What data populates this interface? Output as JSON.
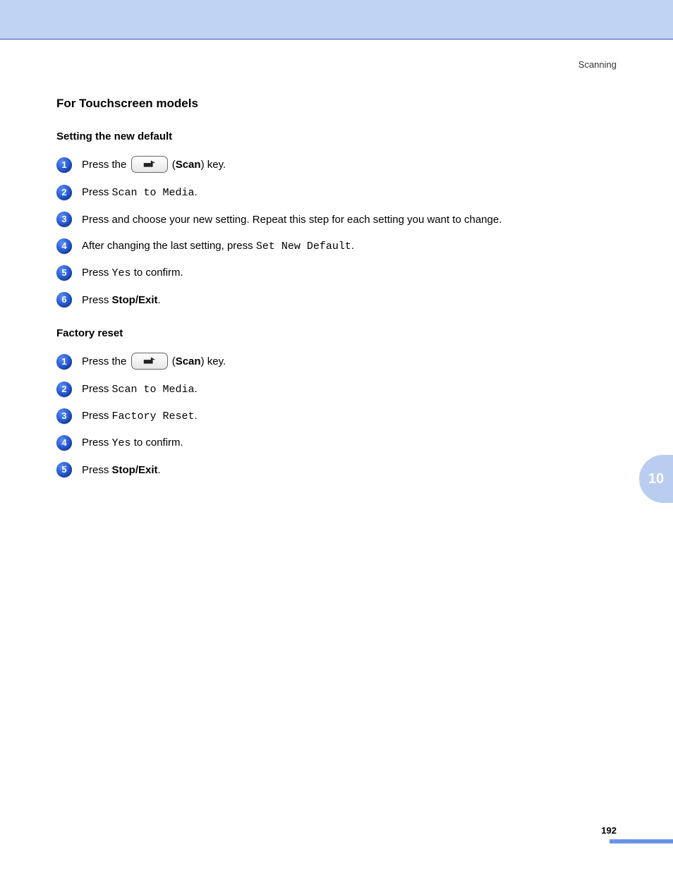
{
  "header": {
    "section": "Scanning"
  },
  "main_heading": "For Touchscreen models",
  "section_a": {
    "heading": "Setting the new default",
    "steps": [
      {
        "num": "1",
        "pre": "Press the ",
        "has_key": true,
        "post_open": " (",
        "bold": "Scan",
        "post_close": ") key."
      },
      {
        "num": "2",
        "pre": "Press ",
        "mono": "Scan to Media",
        "post": "."
      },
      {
        "num": "3",
        "text": "Press and choose your new setting. Repeat this step for each setting you want to change."
      },
      {
        "num": "4",
        "pre": "After changing the last setting, press ",
        "mono": "Set New Default",
        "post": "."
      },
      {
        "num": "5",
        "pre": "Press ",
        "mono": "Yes",
        "post": " to confirm."
      },
      {
        "num": "6",
        "pre": "Press ",
        "bold": "Stop/Exit",
        "post": "."
      }
    ]
  },
  "section_b": {
    "heading": "Factory reset",
    "steps": [
      {
        "num": "1",
        "pre": "Press the ",
        "has_key": true,
        "post_open": " (",
        "bold": "Scan",
        "post_close": ") key."
      },
      {
        "num": "2",
        "pre": "Press ",
        "mono": "Scan to Media",
        "post": "."
      },
      {
        "num": "3",
        "pre": "Press ",
        "mono": "Factory Reset",
        "post": "."
      },
      {
        "num": "4",
        "pre": "Press ",
        "mono": "Yes",
        "post": " to confirm."
      },
      {
        "num": "5",
        "pre": "Press ",
        "bold": "Stop/Exit",
        "post": "."
      }
    ]
  },
  "side_tab": "10",
  "page_number": "192"
}
